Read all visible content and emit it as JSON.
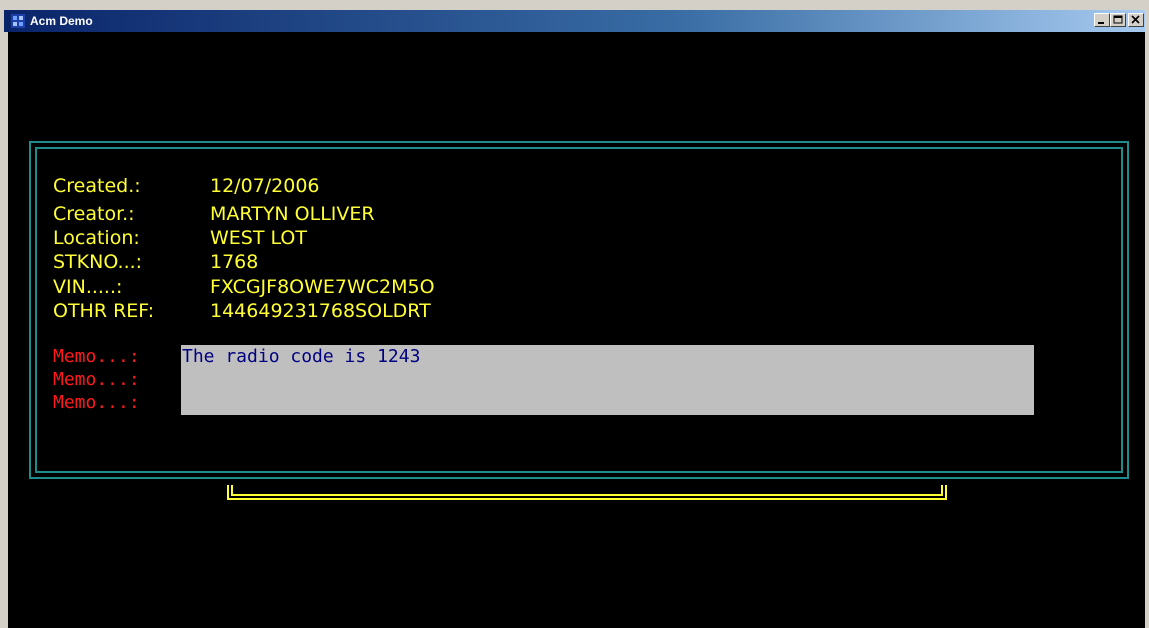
{
  "window": {
    "title": "Acm Demo"
  },
  "record": {
    "fields": [
      {
        "label": "Created.:",
        "value": "12/07/2006"
      },
      {
        "label": "Creator.:",
        "value": "MARTYN OLLIVER"
      },
      {
        "label": "Location:",
        "value": "WEST LOT"
      },
      {
        "label": "STKNO...:",
        "value": "1768"
      },
      {
        "label": "VIN.....:",
        "value": "FXCGJF8OWE7WC2M5O"
      },
      {
        "label": "OTHR REF:",
        "value": "144649231768SOLDRT"
      }
    ],
    "memos": [
      {
        "label": "Memo...:",
        "value": "The radio code is 1243"
      },
      {
        "label": "Memo...:",
        "value": ""
      },
      {
        "label": "Memo...:",
        "value": ""
      }
    ]
  },
  "colors": {
    "console_background": "#000000",
    "frame": "#1f8c8c",
    "field_text": "#ffff33",
    "memo_label": "#ff1a1a",
    "memo_background": "#c0bfc0",
    "memo_text": "#000080",
    "bracket": "#ffff33"
  },
  "icons": {
    "app": "app-icon",
    "minimize": "minimize-icon",
    "maximize": "maximize-icon",
    "close": "close-icon"
  }
}
